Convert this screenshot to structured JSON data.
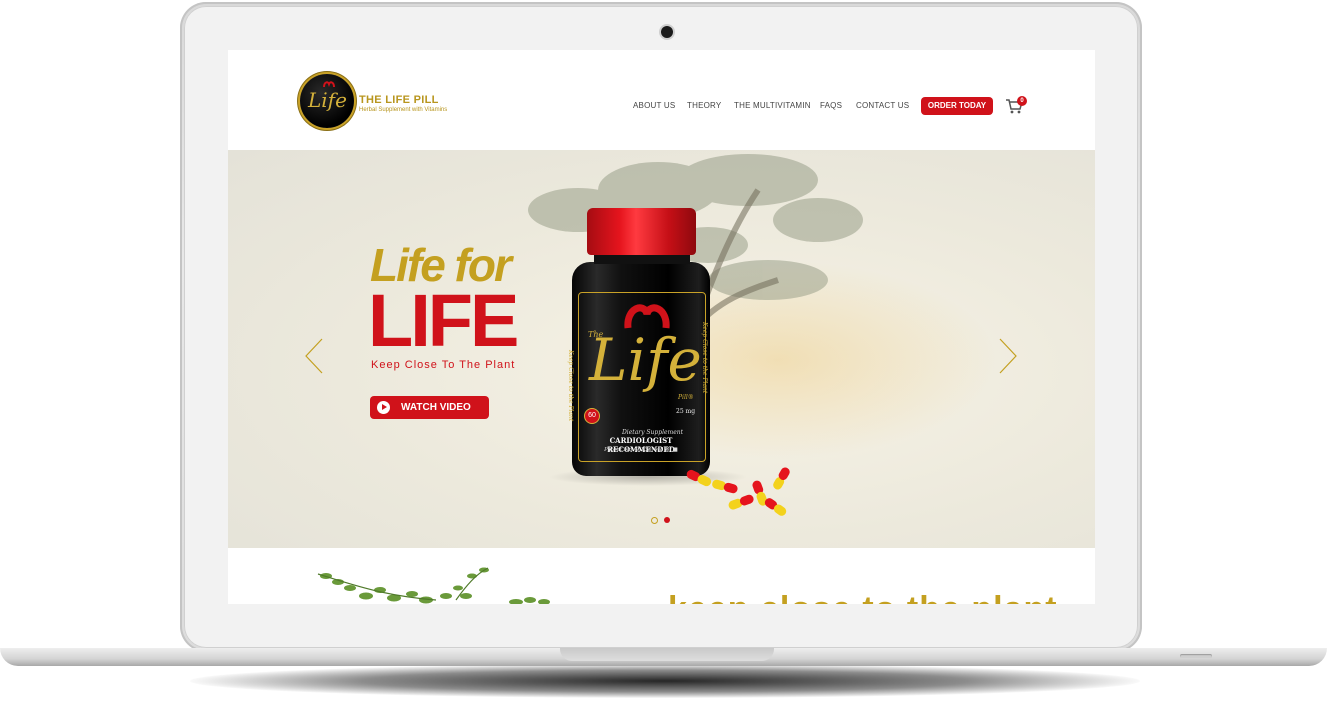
{
  "brand": {
    "logo_text": "Life",
    "title": "THE LIFE PILL",
    "subtitle": "Herbal Supplement with Vitamins"
  },
  "nav": {
    "items": [
      "ABOUT US",
      "THEORY",
      "THE MULTIVITAMIN",
      "FAQS",
      "CONTACT US"
    ],
    "order_label": "ORDER TODAY",
    "cart_count": "0"
  },
  "hero": {
    "headline_top": "Life for",
    "headline_main": "LIFE",
    "tagline": "Keep Close To The Plant",
    "watch_label": "WATCH VIDEO",
    "slides_total": 2,
    "active_slide": 2
  },
  "bottle": {
    "the": "The",
    "word": "Life",
    "pill": "Pill®",
    "count": "60",
    "dosage": "25 mg",
    "dietary": "Dietary Supplement",
    "recommended": "CARDIOLOGIST RECOMMENDED",
    "patent": "Patent No. 9,138,448 B1■",
    "side_text": "Keep Close to the Plant"
  },
  "section2": {
    "heading": "keep close to the plant"
  },
  "colors": {
    "brand_red": "#d0121a",
    "brand_gold": "#c4a020"
  }
}
